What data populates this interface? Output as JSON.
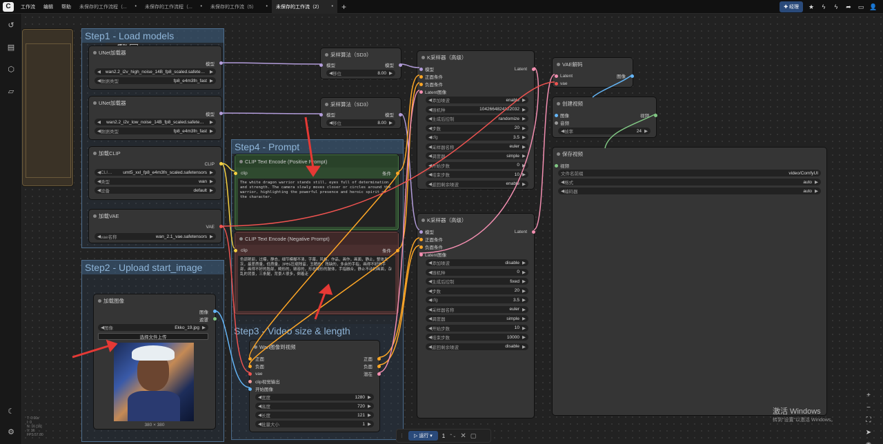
{
  "topbar": {
    "logo": "C",
    "menus": [
      "工作流",
      "编辑",
      "帮助"
    ],
    "tabs": [
      {
        "label": "未保存的工作流程（...",
        "close": "•"
      },
      {
        "label": "未保存的工作流程（...",
        "close": "•"
      },
      {
        "label": "未保存的工作流（5）",
        "close": "•"
      },
      {
        "label": "未保存的工作流（2）",
        "close": "•",
        "active": true
      }
    ],
    "new_tab": "+",
    "manager_label": "经理"
  },
  "groups": {
    "step1": "Step1 - Load models",
    "step2": "Step2 - Upload start_image",
    "step3": "Step3 - Video size & length",
    "step4": "Step4 -  Prompt"
  },
  "unet1": {
    "title": "UNet加载器",
    "out": "模型",
    "model_name": "wan2.2_i2v_high_noise_14B_fp8_scaled.safete…",
    "dtype_label": "数据类型",
    "dtype": "fp8_e4m3fn_fast"
  },
  "unet2": {
    "title": "UNet加载器",
    "out": "模型",
    "model_name": "wan2.2_i2v_low_noise_14B_fp8_scaled.safete…",
    "dtype_label": "数据类型",
    "dtype": "fp8_e4m3fn_fast"
  },
  "toolbar_small": {
    "label": "模型"
  },
  "clip": {
    "title": "加载CLIP",
    "out": "CLIP",
    "name_label": "CLI…",
    "name": "umt5_xxl_fp8_e4m3fn_scaled.safetensors",
    "type_label": "类型",
    "type": "wan",
    "device_label": "设备",
    "device": "default"
  },
  "vae": {
    "title": "加载VAE",
    "out": "VAE",
    "name_label": "vae名称",
    "name": "wan_2.1_vae.safetensors"
  },
  "loadimg": {
    "title": "加载图像",
    "out1": "图像",
    "out2": "遮罩",
    "image_label": "图像",
    "image": "Ekko_19.jpg",
    "upload": "选择文件上传",
    "size": "380 × 380"
  },
  "sampling1": {
    "title": "采样算法（SD3）",
    "in": "模型",
    "out": "模型",
    "shift_label": "移位",
    "shift": "8.00"
  },
  "sampling2": {
    "title": "采样算法（SD3）",
    "in": "模型",
    "out": "模型",
    "shift_label": "移位",
    "shift": "8.00"
  },
  "pos": {
    "title": "CLIP Text Encode (Positive Prompt)",
    "in": "clip",
    "out": "条件",
    "text": "The white dragon warrior stands still, eyes full of determination and strength. The camera slowly moves closer or circles around the warrior, highlighting the powerful presence and heroic spirit of the character."
  },
  "neg": {
    "title": "CLIP Text Encode (Negative Prompt)",
    "in": "clip",
    "out": "条件",
    "text": "色调艳丽，过曝，静态，细节模糊不清，字幕，风格，作品，画作，画面，静止，整体发灰，最差质量，低质量，JPEG压缩残留，丑陋的，残缺的，多余的手指，画得不好的手部，画得不好的脸部，畸形的，毁容的，形态畸形的肢体，手指融合，静止不动的画面，杂乱的背景，三条腿，背景人很多，倒着走"
  },
  "ksampler1": {
    "title": "K采样器（高级）",
    "out": "Latent",
    "inputs": [
      "模型",
      "正面条件",
      "负面条件",
      "Latent图像"
    ],
    "widgets": [
      {
        "l": "添加噪波",
        "v": "enable"
      },
      {
        "l": "随机种",
        "v": "1042664824122032"
      },
      {
        "l": "生成后控制",
        "v": "randomize"
      },
      {
        "l": "步数",
        "v": "20"
      },
      {
        "l": "cfg",
        "v": "3.5"
      },
      {
        "l": "采样器名称",
        "v": "euler"
      },
      {
        "l": "调度器",
        "v": "simple"
      },
      {
        "l": "开始步数",
        "v": "0"
      },
      {
        "l": "结束步数",
        "v": "10"
      },
      {
        "l": "返回剩余噪波",
        "v": "enable"
      }
    ]
  },
  "ksampler2": {
    "title": "K采样器（高级）",
    "out": "Latent",
    "inputs": [
      "模型",
      "正面条件",
      "负面条件",
      "Latent图像"
    ],
    "widgets": [
      {
        "l": "添加噪波",
        "v": "disable"
      },
      {
        "l": "随机种",
        "v": "0"
      },
      {
        "l": "生成后控制",
        "v": "fixed"
      },
      {
        "l": "步数",
        "v": "20"
      },
      {
        "l": "cfg",
        "v": "3.5"
      },
      {
        "l": "采样器名称",
        "v": "euler"
      },
      {
        "l": "调度器",
        "v": "simple"
      },
      {
        "l": "开始步数",
        "v": "10"
      },
      {
        "l": "结束步数",
        "v": "10000"
      },
      {
        "l": "返回剩余噪波",
        "v": "disable"
      }
    ]
  },
  "vaedecode": {
    "title": "VAE解码",
    "in1": "Latent",
    "in2": "vae",
    "out": "图像"
  },
  "createvideo": {
    "title": "创建视频",
    "in1": "图像",
    "in2": "音频",
    "out": "视频",
    "fps_label": "帧率",
    "fps": "24"
  },
  "savevideo": {
    "title": "保存视频",
    "in": "视频",
    "prefix_label": "文件名前缀",
    "prefix": "video/ComfyUI",
    "format_label": "格式",
    "format": "auto",
    "codec_label": "编码器",
    "codec": "auto"
  },
  "wan": {
    "title": "Wan图像到视频",
    "inputs": [
      "正面",
      "负面",
      "vae",
      "clip视觉输出",
      "开始图像"
    ],
    "outputs": [
      "正面",
      "负面",
      "潜在"
    ],
    "widgets": [
      {
        "l": "宽度",
        "v": "1280"
      },
      {
        "l": "高度",
        "v": "720"
      },
      {
        "l": "长度",
        "v": "121"
      },
      {
        "l": "批量大小",
        "v": "1"
      }
    ]
  },
  "run": {
    "label": "运行",
    "count": "1"
  },
  "stats": [
    "T: 0.00s",
    "I: 0",
    "N: 16 [16]",
    "V: 36",
    "FPS:57.80"
  ],
  "watermark": {
    "line1": "激活 Windows",
    "line2": "转到\"设置\"以激活 Windows。"
  }
}
